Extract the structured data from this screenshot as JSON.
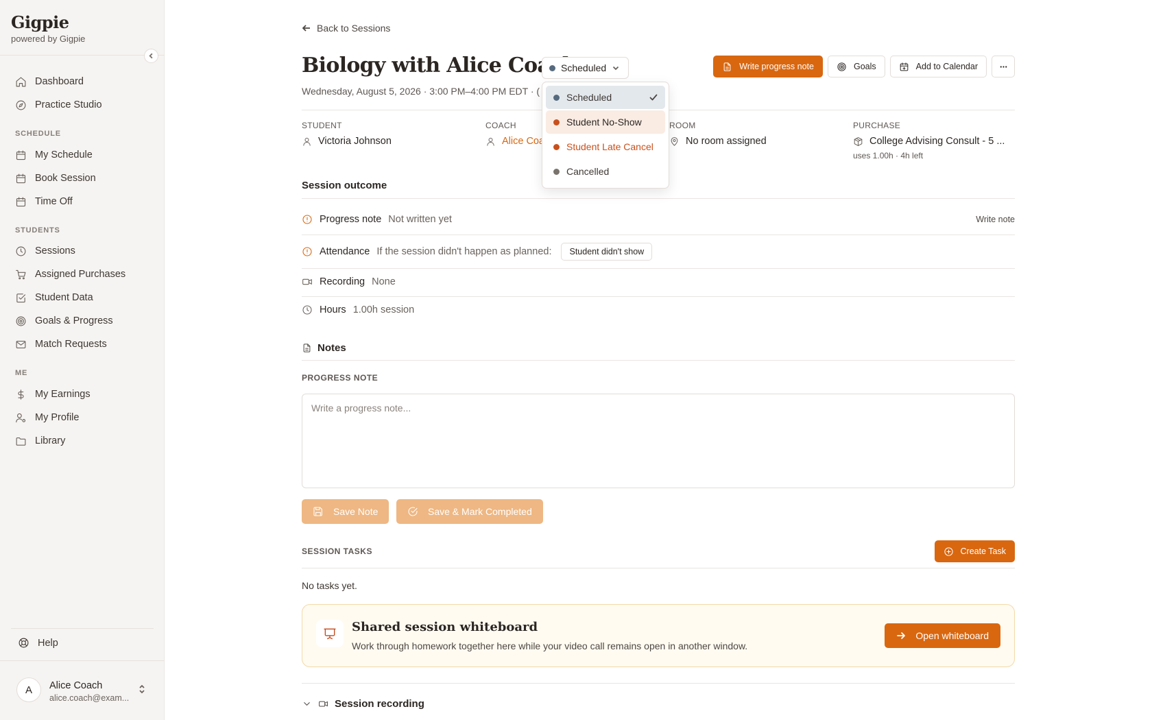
{
  "sidebar": {
    "brand": "Gigpie",
    "brand_sub": "powered by Gigpie",
    "items_top": [
      {
        "label": "Dashboard",
        "icon": "home-icon"
      },
      {
        "label": "Practice Studio",
        "icon": "compass-icon"
      }
    ],
    "schedule_title": "SCHEDULE",
    "schedule": [
      {
        "label": "My Schedule",
        "icon": "calendar-icon"
      },
      {
        "label": "Book Session",
        "icon": "calendar-icon"
      },
      {
        "label": "Time Off",
        "icon": "calendar-icon"
      }
    ],
    "students_title": "STUDENTS",
    "students": [
      {
        "label": "Sessions",
        "icon": "clock-icon"
      },
      {
        "label": "Assigned Purchases",
        "icon": "cart-icon"
      },
      {
        "label": "Student Data",
        "icon": "checkbox-icon"
      },
      {
        "label": "Goals & Progress",
        "icon": "target-icon"
      },
      {
        "label": "Match Requests",
        "icon": "mail-icon"
      }
    ],
    "me_title": "ME",
    "me": [
      {
        "label": "My Earnings",
        "icon": "dollar-icon"
      },
      {
        "label": "My Profile",
        "icon": "user-cog-icon"
      },
      {
        "label": "Library",
        "icon": "folder-icon"
      }
    ],
    "help": "Help",
    "user": {
      "initial": "A",
      "name": "Alice Coach",
      "email": "alice.coach@exam..."
    }
  },
  "header": {
    "back": "Back to Sessions",
    "title": "Biology with Alice Coach",
    "status": "Scheduled",
    "datetime": "Wednesday, August 5, 2026 · 3:00 PM–4:00 PM EDT · (",
    "actions": {
      "write_note": "Write progress note",
      "goals": "Goals",
      "add_calendar": "Add to Calendar"
    }
  },
  "meta": {
    "student_label": "STUDENT",
    "student": "Victoria Johnson",
    "coach_label": "COACH",
    "coach": "Alice Coa",
    "room_label": "ROOM",
    "room": "No room assigned",
    "purchase_label": "PURCHASE",
    "purchase": "College Advising Consult - 5 ...",
    "purchase_sub": "uses 1.00h · 4h left"
  },
  "outcome": {
    "title": "Session outcome",
    "progress_label": "Progress note",
    "progress_value": "Not written yet",
    "progress_action": "Write note",
    "attendance_label": "Attendance",
    "attendance_value": "If the session didn't happen as planned:",
    "attendance_button": "Student didn't show",
    "recording_label": "Recording",
    "recording_value": "None",
    "hours_label": "Hours",
    "hours_value": "1.00h session"
  },
  "notes": {
    "title": "Notes",
    "progress_caps": "PROGRESS NOTE",
    "placeholder": "Write a progress note...",
    "save": "Save Note",
    "save_complete": "Save & Mark Completed"
  },
  "tasks": {
    "caps": "SESSION TASKS",
    "create": "Create Task",
    "empty": "No tasks yet."
  },
  "whiteboard": {
    "title": "Shared session whiteboard",
    "desc": "Work through homework together here while your video call remains open in another window.",
    "button": "Open whiteboard"
  },
  "recording_section": "Session recording",
  "dropdown": {
    "options": [
      {
        "label": "Scheduled",
        "color": "#566a7e",
        "state": "selected"
      },
      {
        "label": "Student No-Show",
        "color": "#c8501d",
        "state": "hover"
      },
      {
        "label": "Student Late Cancel",
        "color": "#c8501d",
        "state": "orange"
      },
      {
        "label": "Cancelled",
        "color": "#7a736d",
        "state": "normal"
      }
    ]
  },
  "colors": {
    "accent": "#d9670f",
    "status_scheduled": "#566a7e"
  }
}
